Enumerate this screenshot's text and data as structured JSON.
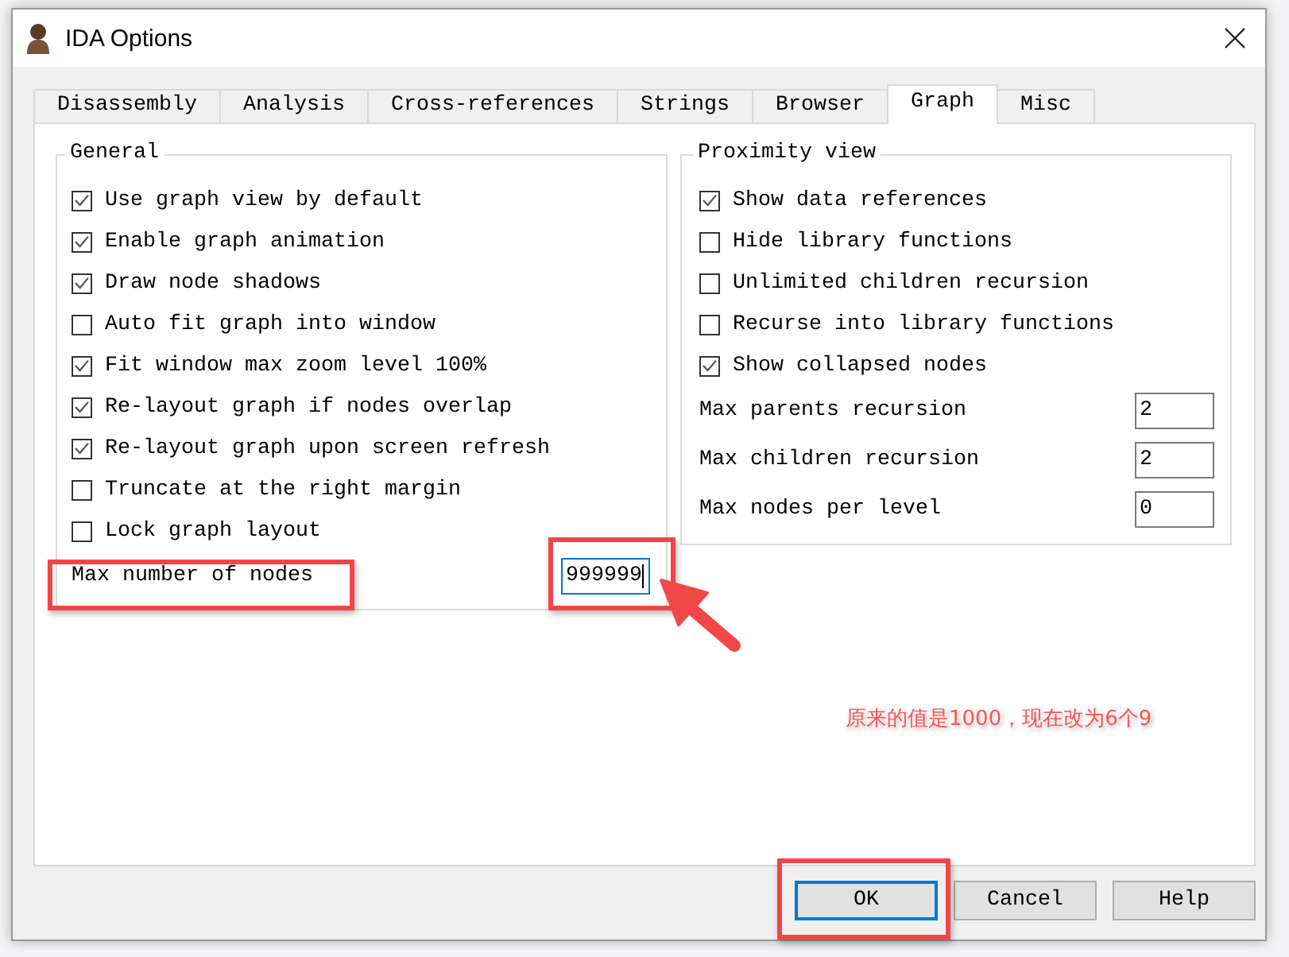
{
  "window": {
    "title": "IDA Options"
  },
  "tabs": [
    {
      "label": "Disassembly",
      "selected": false
    },
    {
      "label": "Analysis",
      "selected": false
    },
    {
      "label": "Cross-references",
      "selected": false
    },
    {
      "label": "Strings",
      "selected": false
    },
    {
      "label": "Browser",
      "selected": false
    },
    {
      "label": "Graph",
      "selected": true
    },
    {
      "label": "Misc",
      "selected": false
    }
  ],
  "groups": [
    {
      "title": "General",
      "options": [
        {
          "label": "Use graph view by default",
          "checked": true
        },
        {
          "label": "Enable graph animation",
          "checked": true
        },
        {
          "label": "Draw node shadows",
          "checked": true
        },
        {
          "label": "Auto fit graph into window",
          "checked": false
        },
        {
          "label": "Fit window max zoom level 100%",
          "checked": true
        },
        {
          "label": "Re-layout graph if nodes overlap",
          "checked": true
        },
        {
          "label": "Re-layout graph upon screen refresh",
          "checked": true
        },
        {
          "label": "Truncate at the right margin",
          "checked": false
        },
        {
          "label": "Lock graph layout",
          "checked": false
        }
      ],
      "fields": [
        {
          "label": "Max number of nodes",
          "value": "999999",
          "focused": true
        }
      ]
    },
    {
      "title": "Proximity view",
      "options": [
        {
          "label": "Show data references",
          "checked": true
        },
        {
          "label": "Hide library functions",
          "checked": false
        },
        {
          "label": "Unlimited children recursion",
          "checked": false
        },
        {
          "label": "Recurse into library functions",
          "checked": false
        },
        {
          "label": "Show collapsed nodes",
          "checked": true
        }
      ],
      "fields": [
        {
          "label": "Max parents recursion",
          "value": "2",
          "focused": false
        },
        {
          "label": "Max children recursion",
          "value": "2",
          "focused": false
        },
        {
          "label": "Max nodes per level",
          "value": "0",
          "focused": false
        }
      ]
    }
  ],
  "buttons": [
    {
      "label": "OK",
      "default": true
    },
    {
      "label": "Cancel",
      "default": false
    },
    {
      "label": "Help",
      "default": false
    }
  ],
  "annotation": {
    "note": "原来的值是1000，现在改为6个9"
  }
}
